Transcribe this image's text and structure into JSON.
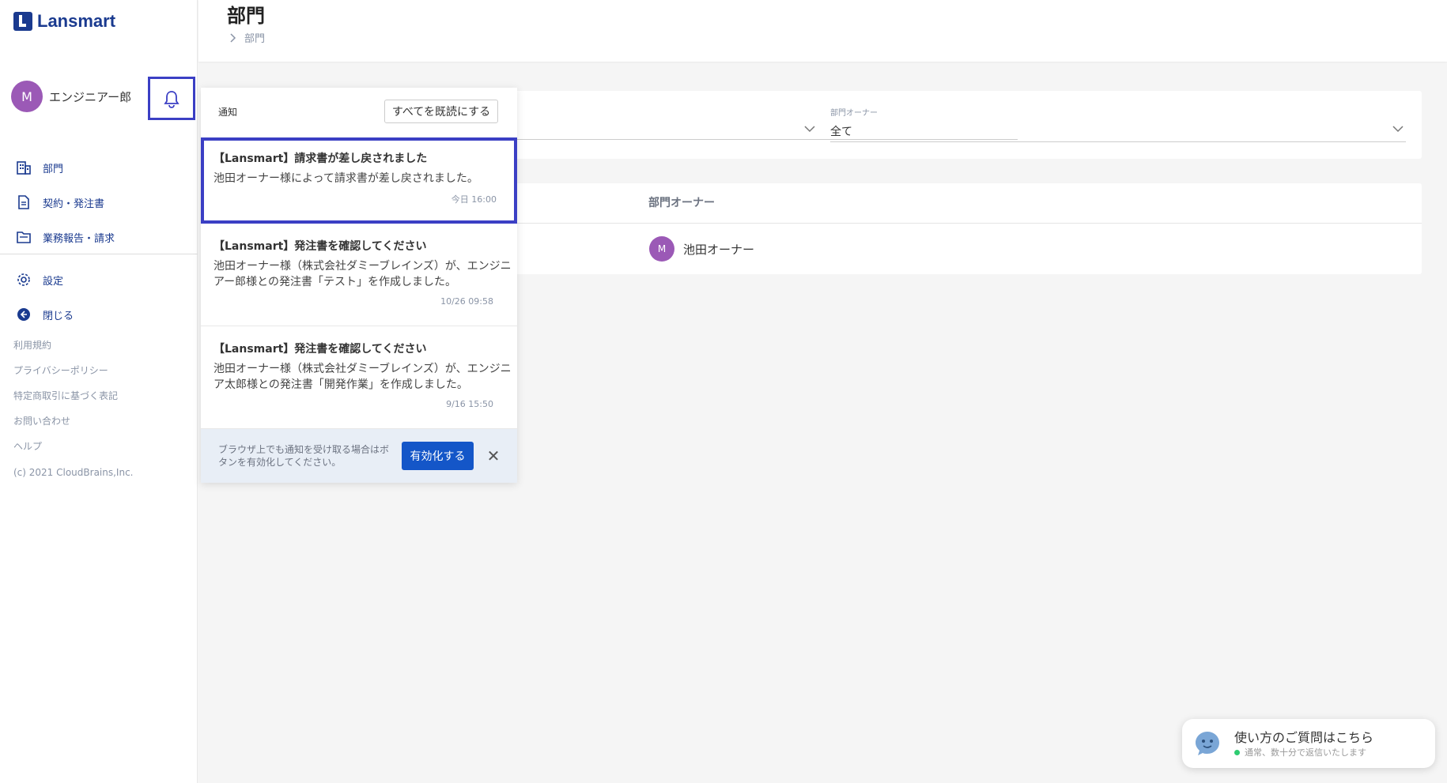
{
  "brand": {
    "name": "Lansmart"
  },
  "user": {
    "initial": "M",
    "name": "エンジニアー郎"
  },
  "nav": [
    {
      "label": "部門"
    },
    {
      "label": "契約・発注書"
    },
    {
      "label": "業務報告・請求"
    }
  ],
  "nav2": [
    {
      "label": "設定"
    },
    {
      "label": "閉じる"
    }
  ],
  "links": [
    "利用規約",
    "プライバシーポリシー",
    "特定商取引に基づく表記",
    "お問い合わせ",
    "ヘルプ"
  ],
  "copyright": "(c) 2021 CloudBrains,Inc.",
  "header": {
    "title": "部門",
    "breadcrumb": "部門"
  },
  "filter": {
    "owner_label": "部門オーナー",
    "owner_value": "全て"
  },
  "table": {
    "columns": [
      "部門オーナー"
    ],
    "rows": [
      {
        "avatar": "M",
        "owner": "池田オーナー"
      }
    ]
  },
  "notifications": {
    "title": "通知",
    "mark_all": "すべてを既読にする",
    "items": [
      {
        "title": "【Lansmart】請求書が差し戻されました",
        "body": "池田オーナー様によって請求書が差し戻されました。",
        "time": "今日 16:00"
      },
      {
        "title": "【Lansmart】発注書を確認してください",
        "body": "池田オーナー様（株式会社ダミーブレインズ）が、エンジニアー郎様との発注書「テスト」を作成しました。",
        "time": "10/26 09:58"
      },
      {
        "title": "【Lansmart】発注書を確認してください",
        "body": "池田オーナー様（株式会社ダミーブレインズ）が、エンジニア太郎様との発注書「開発作業」を作成しました。",
        "time": "9/16 15:50"
      }
    ],
    "footer_text": "ブラウザ上でも通知を受け取る場合はボタンを有効化してください。",
    "enable_button": "有効化する"
  },
  "help": {
    "title": "使い方のご質問はこちら",
    "subtitle": "通常、数十分で返信いたします"
  },
  "colors": {
    "brand": "#1a3a8f",
    "accent": "#1456c8",
    "highlight": "#3b3fc4",
    "avatar": "#9b59b6"
  }
}
